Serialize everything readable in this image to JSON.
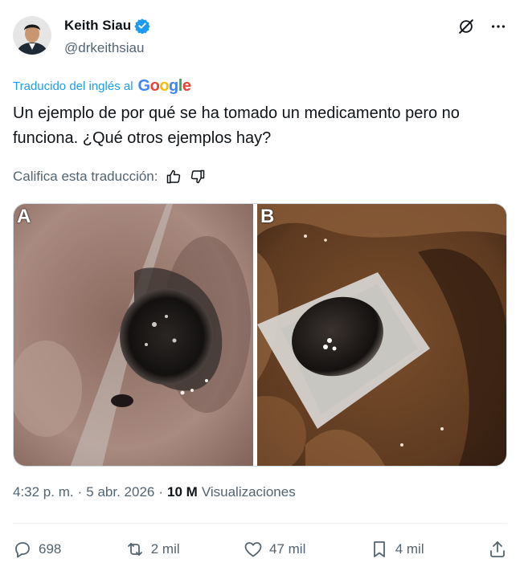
{
  "author": {
    "name": "Keith Siau",
    "handle": "@drkeithsiau"
  },
  "translation": {
    "label": "Traducido del inglés al",
    "provider": "Google"
  },
  "tweet": {
    "text": "Un ejemplo de por qué se ha tomado un medicamento pero no funciona. ¿Qué otros ejemplos hay?"
  },
  "rating": {
    "label": "Califica esta traducción:"
  },
  "media": {
    "panel_a_label": "A",
    "panel_b_label": "B"
  },
  "meta": {
    "time": "4:32 p. m.",
    "date": "5 abr. 2026",
    "separator": "·",
    "views_count": "10 M",
    "views_label": "Visualizaciones"
  },
  "actions": {
    "replies": "698",
    "reposts": "2 mil",
    "likes": "47 mil",
    "bookmarks": "4 mil"
  },
  "colors": {
    "accent": "#1d9bf0",
    "text": "#0f1419",
    "muted": "#536471"
  }
}
